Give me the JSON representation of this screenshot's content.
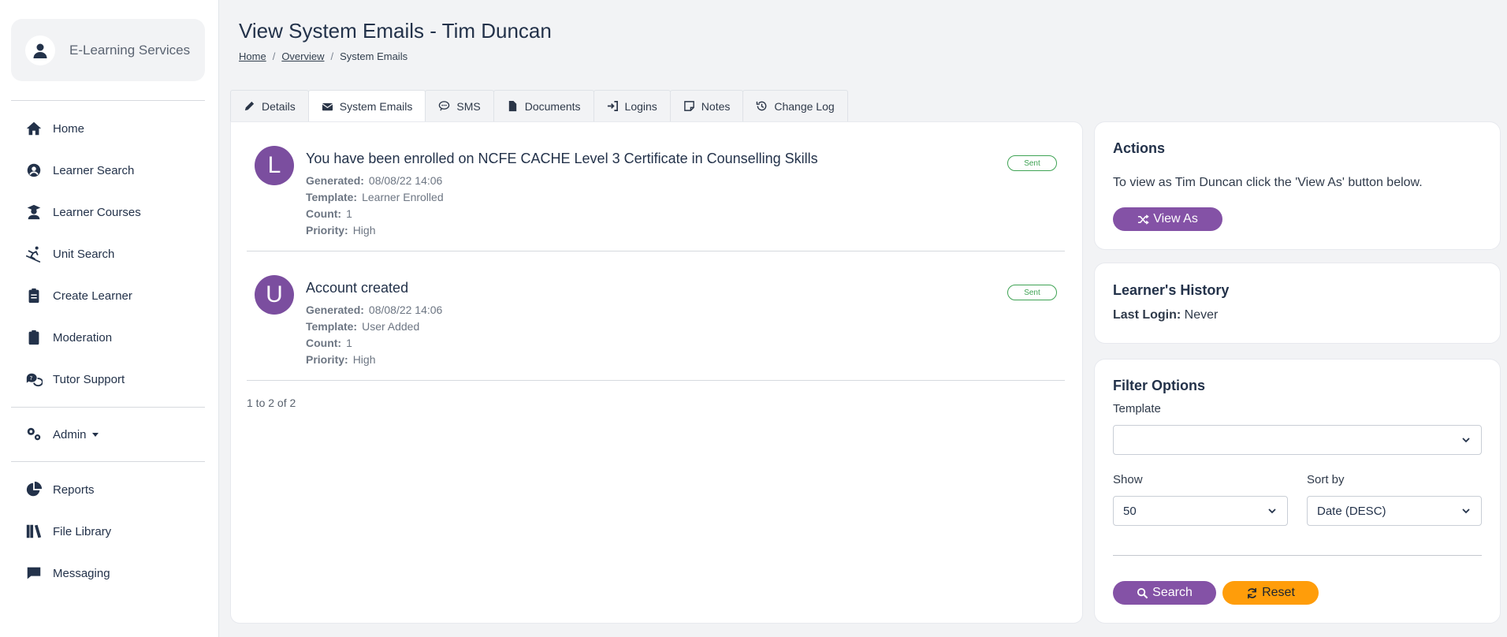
{
  "sidebar": {
    "user_name": "E-Learning Services",
    "items": [
      {
        "label": "Home",
        "icon": "home-icon"
      },
      {
        "label": "Learner Search",
        "icon": "user-circle-icon"
      },
      {
        "label": "Learner Courses",
        "icon": "graduate-icon"
      },
      {
        "label": "Unit Search",
        "icon": "skiing-icon"
      },
      {
        "label": "Create Learner",
        "icon": "clipboard-list-icon"
      },
      {
        "label": "Moderation",
        "icon": "clipboard-icon"
      },
      {
        "label": "Tutor Support",
        "icon": "question-chat-icon"
      },
      {
        "label": "Admin",
        "icon": "gears-icon"
      },
      {
        "label": "Reports",
        "icon": "pie-chart-icon"
      },
      {
        "label": "File Library",
        "icon": "books-icon"
      },
      {
        "label": "Messaging",
        "icon": "chat-icon"
      }
    ]
  },
  "page": {
    "title": "View System Emails - Tim Duncan",
    "breadcrumb": [
      "Home",
      "Overview",
      "System Emails"
    ],
    "breadcrumb_sep": "/"
  },
  "tabs": [
    {
      "label": "Details",
      "icon": "pencil-icon"
    },
    {
      "label": "System Emails",
      "icon": "envelope-icon"
    },
    {
      "label": "SMS",
      "icon": "comment-icon"
    },
    {
      "label": "Documents",
      "icon": "file-icon"
    },
    {
      "label": "Logins",
      "icon": "sign-in-icon"
    },
    {
      "label": "Notes",
      "icon": "note-icon"
    },
    {
      "label": "Change Log",
      "icon": "history-icon"
    }
  ],
  "emails": [
    {
      "letter": "L",
      "subject": "You have been enrolled on NCFE CACHE Level 3 Certificate in Counselling Skills",
      "generated": "08/08/22 14:06",
      "template": "Learner Enrolled",
      "count": "1",
      "priority": "High",
      "status": "Sent"
    },
    {
      "letter": "U",
      "subject": "Account created",
      "generated": "08/08/22 14:06",
      "template": "User Added",
      "count": "1",
      "priority": "High",
      "status": "Sent"
    }
  ],
  "meta_labels": {
    "generated": "Generated:",
    "template": "Template:",
    "count": "Count:",
    "priority": "Priority:"
  },
  "pager": "1 to 2 of 2",
  "actions": {
    "title": "Actions",
    "text": "To view as Tim Duncan click the 'View As' button below.",
    "button": "View As"
  },
  "history": {
    "title": "Learner's History",
    "last_login_label": "Last Login:",
    "last_login_value": "Never"
  },
  "filter": {
    "title": "Filter Options",
    "template_label": "Template",
    "template_value": "",
    "show_label": "Show",
    "show_value": "50",
    "sort_label": "Sort by",
    "sort_value": "Date (DESC)",
    "search_button": "Search",
    "reset_button": "Reset"
  },
  "colors": {
    "accent": "#8452a6",
    "avatar": "#7b4e9f",
    "warning": "#ff9d0a",
    "success": "#3fa354"
  }
}
